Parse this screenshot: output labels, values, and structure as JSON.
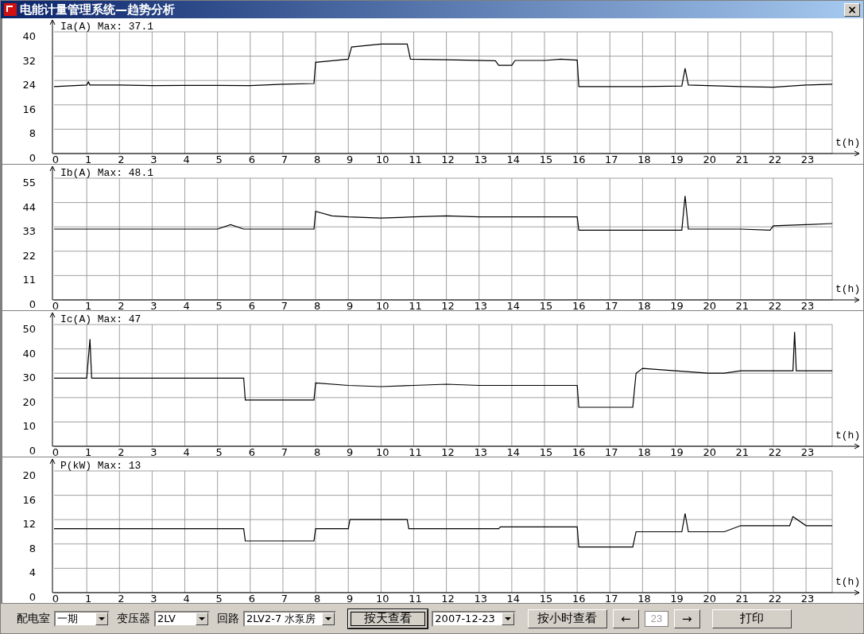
{
  "window": {
    "title": "电能计量管理系统—趋势分析",
    "close": "×"
  },
  "charts": [
    {
      "chart_data": {
        "type": "line",
        "title": "Ia(A) Max: 37.1",
        "xlabel": "t(h)",
        "xlim": [
          0,
          23.8
        ],
        "ylim": [
          0,
          40
        ],
        "yticks": [
          0,
          8,
          16,
          24,
          32,
          40
        ],
        "xticks": [
          0,
          1,
          2,
          3,
          4,
          5,
          6,
          7,
          8,
          9,
          10,
          11,
          12,
          13,
          14,
          15,
          16,
          17,
          18,
          19,
          20,
          21,
          22,
          23
        ],
        "x": [
          0,
          1,
          1.05,
          1.1,
          2,
          3,
          4,
          5,
          6,
          7,
          7.95,
          8,
          8.5,
          9,
          9.1,
          10,
          10.8,
          10.9,
          12,
          13.5,
          13.6,
          14,
          14.1,
          15,
          15.5,
          16,
          16.05,
          17,
          18,
          19.2,
          19.3,
          19.4,
          20,
          21,
          22,
          23,
          23.8
        ],
        "grid": true,
        "series": [
          {
            "color": "#000000",
            "values": [
              22,
              22.5,
              23.5,
              22.5,
              22.5,
              22.3,
              22.4,
              22.4,
              22.3,
              22.8,
              23,
              30,
              30.5,
              31,
              35,
              36,
              36,
              31,
              30.8,
              30.5,
              29,
              29,
              30.6,
              30.6,
              31,
              30.7,
              22,
              22,
              22,
              22.2,
              28,
              22.5,
              22.3,
              22,
              21.8,
              22.5,
              22.8
            ]
          }
        ]
      }
    },
    {
      "chart_data": {
        "type": "line",
        "title": "Ib(A) Max: 48.1",
        "xlabel": "t(h)",
        "xlim": [
          0,
          23.8
        ],
        "ylim": [
          0,
          55
        ],
        "yticks": [
          0,
          11,
          22,
          33,
          44,
          55
        ],
        "xticks": [
          0,
          1,
          2,
          3,
          4,
          5,
          6,
          7,
          8,
          9,
          10,
          11,
          12,
          13,
          14,
          15,
          16,
          17,
          18,
          19,
          20,
          21,
          22,
          23
        ],
        "x": [
          0,
          1,
          2,
          3,
          4,
          5,
          5.4,
          5.8,
          6,
          7,
          7.95,
          8,
          8.5,
          9,
          10,
          11,
          12,
          13,
          14,
          15,
          16,
          16.05,
          17,
          18,
          19.2,
          19.3,
          19.4,
          20,
          21,
          21.9,
          22,
          23,
          23.8
        ],
        "grid": true,
        "series": [
          {
            "color": "#000000",
            "values": [
              32,
              32,
              32,
              32,
              32,
              32,
              34,
              32,
              32,
              32,
              32,
              40,
              38,
              37.5,
              37,
              37.5,
              38,
              37.5,
              37.5,
              37.5,
              37.5,
              31.5,
              31.5,
              31.5,
              31.5,
              47,
              32,
              32,
              32,
              31.5,
              33.5,
              34,
              34.5
            ]
          }
        ]
      }
    },
    {
      "chart_data": {
        "type": "line",
        "title": "Ic(A) Max: 47",
        "xlabel": "t(h)",
        "xlim": [
          0,
          23.8
        ],
        "ylim": [
          0,
          50
        ],
        "yticks": [
          0,
          10,
          20,
          30,
          40,
          50
        ],
        "xticks": [
          0,
          1,
          2,
          3,
          4,
          5,
          6,
          7,
          8,
          9,
          10,
          11,
          12,
          13,
          14,
          15,
          16,
          17,
          18,
          19,
          20,
          21,
          22,
          23
        ],
        "x": [
          0,
          1,
          1.1,
          1.15,
          1.2,
          2,
          3,
          4,
          5,
          5.8,
          5.85,
          7,
          7.95,
          8,
          9,
          10,
          11,
          12,
          13,
          14,
          15,
          16,
          16.05,
          17,
          17.7,
          17.8,
          18,
          19,
          20,
          20.5,
          21,
          22,
          22.6,
          22.65,
          22.7,
          23,
          23.8
        ],
        "grid": true,
        "series": [
          {
            "color": "#000000",
            "values": [
              28,
              28,
              44,
              28,
              28,
              28,
              28,
              28,
              28,
              28,
              19,
              19,
              19,
              26,
              25,
              24.5,
              25,
              25.5,
              25,
              25,
              25,
              25,
              16,
              16,
              16,
              30,
              32,
              31,
              30,
              30,
              31,
              31,
              31,
              47,
              31,
              31,
              31
            ]
          }
        ]
      }
    },
    {
      "chart_data": {
        "type": "line",
        "title": "P(kW) Max: 13",
        "xlabel": "t(h)",
        "xlim": [
          0,
          23.8
        ],
        "ylim": [
          0,
          20
        ],
        "yticks": [
          0,
          4,
          8,
          12,
          16,
          20
        ],
        "xticks": [
          0,
          1,
          2,
          3,
          4,
          5,
          6,
          7,
          8,
          9,
          10,
          11,
          12,
          13,
          14,
          15,
          16,
          17,
          18,
          19,
          20,
          21,
          22,
          23
        ],
        "x": [
          0,
          1,
          2,
          3,
          4,
          5,
          5.8,
          5.85,
          7,
          7.95,
          8,
          9,
          9.05,
          10,
          10.8,
          10.85,
          12,
          13.6,
          13.65,
          15,
          16,
          16.05,
          17,
          17.7,
          17.8,
          19.2,
          19.3,
          19.4,
          20,
          20.5,
          21,
          22,
          22.5,
          22.6,
          23,
          23.8
        ],
        "grid": true,
        "series": [
          {
            "color": "#000000",
            "values": [
              10.5,
              10.5,
              10.5,
              10.5,
              10.5,
              10.5,
              10.5,
              8.5,
              8.5,
              8.5,
              10.5,
              10.5,
              12,
              12,
              12,
              10.5,
              10.5,
              10.5,
              10.8,
              10.8,
              10.8,
              7.5,
              7.5,
              7.5,
              10,
              10,
              13,
              10,
              10,
              10,
              11,
              11,
              11,
              12.5,
              11,
              11
            ]
          }
        ]
      }
    }
  ],
  "toolbar": [
    {
      "kind": "label",
      "text": "配电室"
    },
    {
      "kind": "select",
      "value": "一期"
    },
    {
      "kind": "label",
      "text": "变压器"
    },
    {
      "kind": "select",
      "value": "2LV"
    },
    {
      "kind": "label",
      "text": "回路"
    },
    {
      "kind": "select",
      "value": "2LV2-7 水泵房"
    },
    {
      "kind": "button",
      "text": "按天查看",
      "focused": true
    },
    {
      "kind": "select",
      "value": "2007-12-23"
    },
    {
      "kind": "button",
      "text": "按小时查看",
      "focused": false
    },
    {
      "kind": "button",
      "text": "←",
      "focused": false
    },
    {
      "kind": "input",
      "value": "23",
      "disabled": true
    },
    {
      "kind": "button",
      "text": "→",
      "focused": false
    },
    {
      "kind": "button",
      "text": "打印",
      "focused": false
    }
  ]
}
